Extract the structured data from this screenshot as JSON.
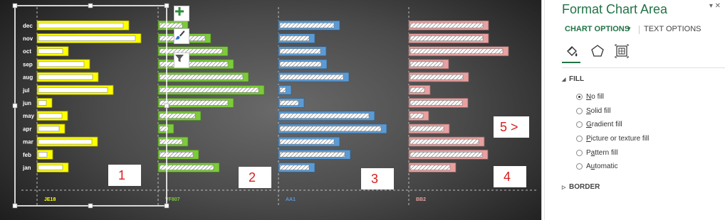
{
  "chart_data": {
    "type": "bar",
    "orientation": "horizontal",
    "categories": [
      "jan",
      "feb",
      "mar",
      "apr",
      "may",
      "jun",
      "jul",
      "aug",
      "sep",
      "oct",
      "nov",
      "dec"
    ],
    "series": [
      {
        "name": "JE18",
        "color": "#ffff00",
        "values": [
          44,
          22,
          85,
          39,
          43,
          21,
          107,
          86,
          74,
          44,
          146,
          129
        ]
      },
      {
        "name": "VF807",
        "color": "#7ccb3a",
        "values": [
          86,
          57,
          42,
          22,
          60,
          106,
          149,
          127,
          106,
          98,
          74,
          42
        ]
      },
      {
        "name": "AA1",
        "color": "#5b9bd5",
        "values": [
          51,
          101,
          86,
          152,
          135,
          36,
          18,
          99,
          68,
          67,
          51,
          86
        ]
      },
      {
        "name": "BB2",
        "color": "#e8a0a0",
        "values": [
          66,
          111,
          106,
          57,
          28,
          83,
          30,
          84,
          56,
          140,
          112,
          112
        ]
      }
    ],
    "panel_numbers": [
      "1",
      "2",
      "3",
      "4",
      "5 >"
    ],
    "gridlines": "vertical dashed",
    "legend": "none"
  },
  "chart_tools": {
    "add_icon": "plus-icon",
    "style_icon": "paintbrush-icon",
    "filter_icon": "filter-icon"
  },
  "pane": {
    "title": "Format Chart Area",
    "controls": "▾ ✕",
    "tab_chart_options": "CHART OPTIONS",
    "tab_chart_options_arrow": "▾",
    "tab_text_options": "TEXT OPTIONS",
    "icons": [
      "fill-line-icon",
      "effects-icon",
      "size-properties-icon"
    ],
    "fill_header": "FILL",
    "fill_options": [
      {
        "prefix": "",
        "key": "N",
        "rest": "o fill",
        "selected": true
      },
      {
        "prefix": "",
        "key": "S",
        "rest": "olid fill",
        "selected": false
      },
      {
        "prefix": "",
        "key": "G",
        "rest": "radient fill",
        "selected": false
      },
      {
        "prefix": "",
        "key": "P",
        "rest": "icture or texture fill",
        "selected": false
      },
      {
        "prefix": "P",
        "key": "a",
        "rest": "ttern fill",
        "selected": false
      },
      {
        "prefix": "A",
        "key": "u",
        "rest": "tomatic",
        "selected": false
      }
    ],
    "border_header": "BORDER"
  },
  "colors": {
    "accent": "#217346",
    "annotation_red": "#d91d1d"
  }
}
